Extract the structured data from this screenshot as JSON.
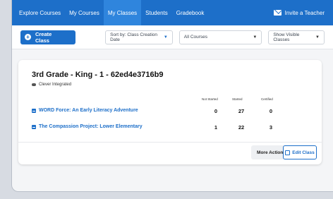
{
  "nav": {
    "items": [
      {
        "label": "Explore Courses",
        "active": false
      },
      {
        "label": "My Courses",
        "active": false
      },
      {
        "label": "My Classes",
        "active": true
      },
      {
        "label": "Students",
        "active": false
      },
      {
        "label": "Gradebook",
        "active": false
      }
    ],
    "invite_label": "Invite a Teacher"
  },
  "toolbar": {
    "create_label": "Create Class",
    "sort_label": "Sort by: Class Creation Date",
    "courses_label": "All Courses",
    "visibility_label": "Show Visible Classes"
  },
  "class_card": {
    "title": "3rd Grade - King - 1 - 62ed4e3716b9",
    "integration": "Clever Integrated",
    "columns": [
      "Not Started",
      "Started",
      "Certified"
    ],
    "courses": [
      {
        "name": "WORD Force: An Early Literacy Adventure",
        "not_started": "0",
        "started": "27",
        "certified": "0"
      },
      {
        "name": "The Compassion Project: Lower Elementary",
        "not_started": "1",
        "started": "22",
        "certified": "3"
      }
    ],
    "more_actions_label": "More Actions",
    "edit_label": "Edit Class"
  },
  "colors": {
    "accent": "#1d6fc9",
    "nav_active": "#2f85dd"
  }
}
